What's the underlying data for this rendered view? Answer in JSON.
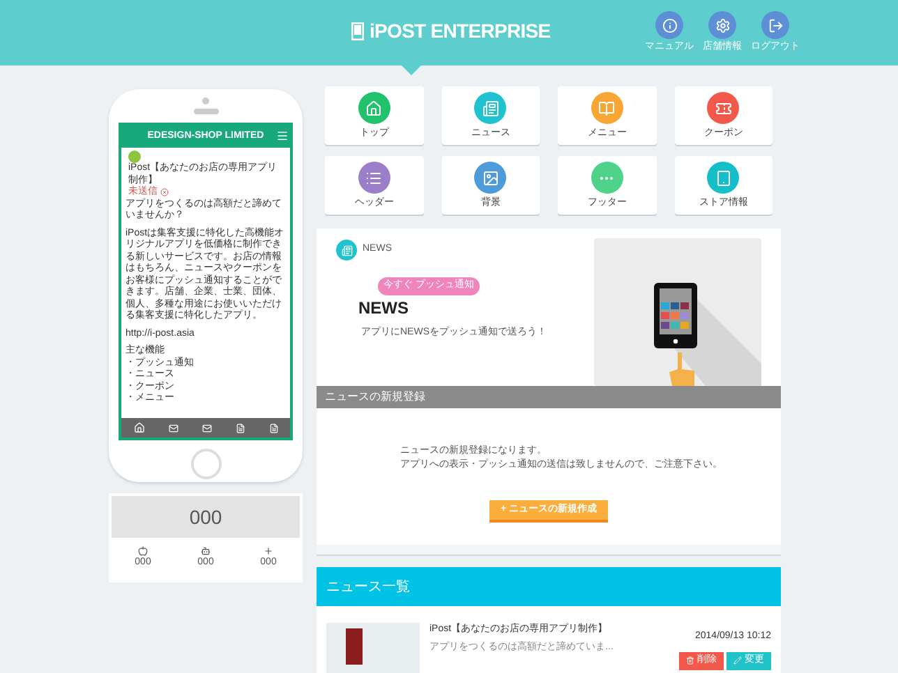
{
  "header": {
    "logo": "iPOST ENTERPRISE",
    "nav": [
      {
        "kind": "info",
        "label": "マニュアル"
      },
      {
        "kind": "gear",
        "label": "店舗情報"
      },
      {
        "kind": "logout",
        "label": "ログアウト"
      }
    ]
  },
  "menu": [
    {
      "kind": "home",
      "label": "トップ",
      "color": "#22c16b"
    },
    {
      "kind": "news",
      "label": "ニュース",
      "color": "#1fc3cf"
    },
    {
      "kind": "book",
      "label": "メニュー",
      "color": "#f7a533"
    },
    {
      "kind": "coupon",
      "label": "クーポン",
      "color": "#f2594b"
    },
    {
      "kind": "list",
      "label": "ヘッダー",
      "color": "#9b7ec8"
    },
    {
      "kind": "image",
      "label": "背景",
      "color": "#4f9bd9"
    },
    {
      "kind": "dots",
      "label": "フッター",
      "color": "#4fd38a"
    },
    {
      "kind": "tablet",
      "label": "ストア情報",
      "color": "#14bfc9"
    }
  ],
  "phone": {
    "shop": "EDESIGN-SHOP LIMITED",
    "title": "iPost【あなたのお店の専用アプリ制作】",
    "status": "未送信",
    "body": [
      "アプリをつくるのは高額だと諦めていませんか？",
      "iPostは集客支援に特化した高機能オリジナルアプリを低価格に制作できる新しいサービスです。お店の情報はもちろん、ニュースやクーポンをお客様にプッシュ通知することができます。店舗、企業、士業、団体、個人、多種な用途にお使いいただける集客支援に特化したアプリ。",
      "http://i-post.asia"
    ],
    "features_title": "主な機能",
    "features": [
      "・プッシュ通知",
      "・ニュース",
      "・クーポン",
      "・メニュー"
    ]
  },
  "counter": {
    "total": "000",
    "platforms": [
      {
        "kind": "apple",
        "count": "000"
      },
      {
        "kind": "android",
        "count": "000"
      },
      {
        "kind": "plus",
        "count": "000"
      }
    ]
  },
  "news_panel": {
    "section": "NEWS",
    "badge": "今すぐ プッシュ通知",
    "heading": "NEWS",
    "tagline": "アプリにNEWSをプッシュ通知で送ろう！"
  },
  "new_entry": {
    "title": "ニュースの新規登録",
    "notes": [
      "ニュースの新規登録になります。",
      "アプリへの表示・プッシュ通知の送信は致しませんので、ご注意下さい。"
    ],
    "button": "+ ニュースの新規作成"
  },
  "news_list": {
    "title": "ニュース一覧",
    "items": [
      {
        "title": "iPost【あなたのお店の専用アプリ制作】",
        "excerpt": "アプリをつくるのは高額だと諦めていま...",
        "date": "2014/09/13 10:12",
        "delete": "削除",
        "edit": "変更"
      }
    ]
  }
}
